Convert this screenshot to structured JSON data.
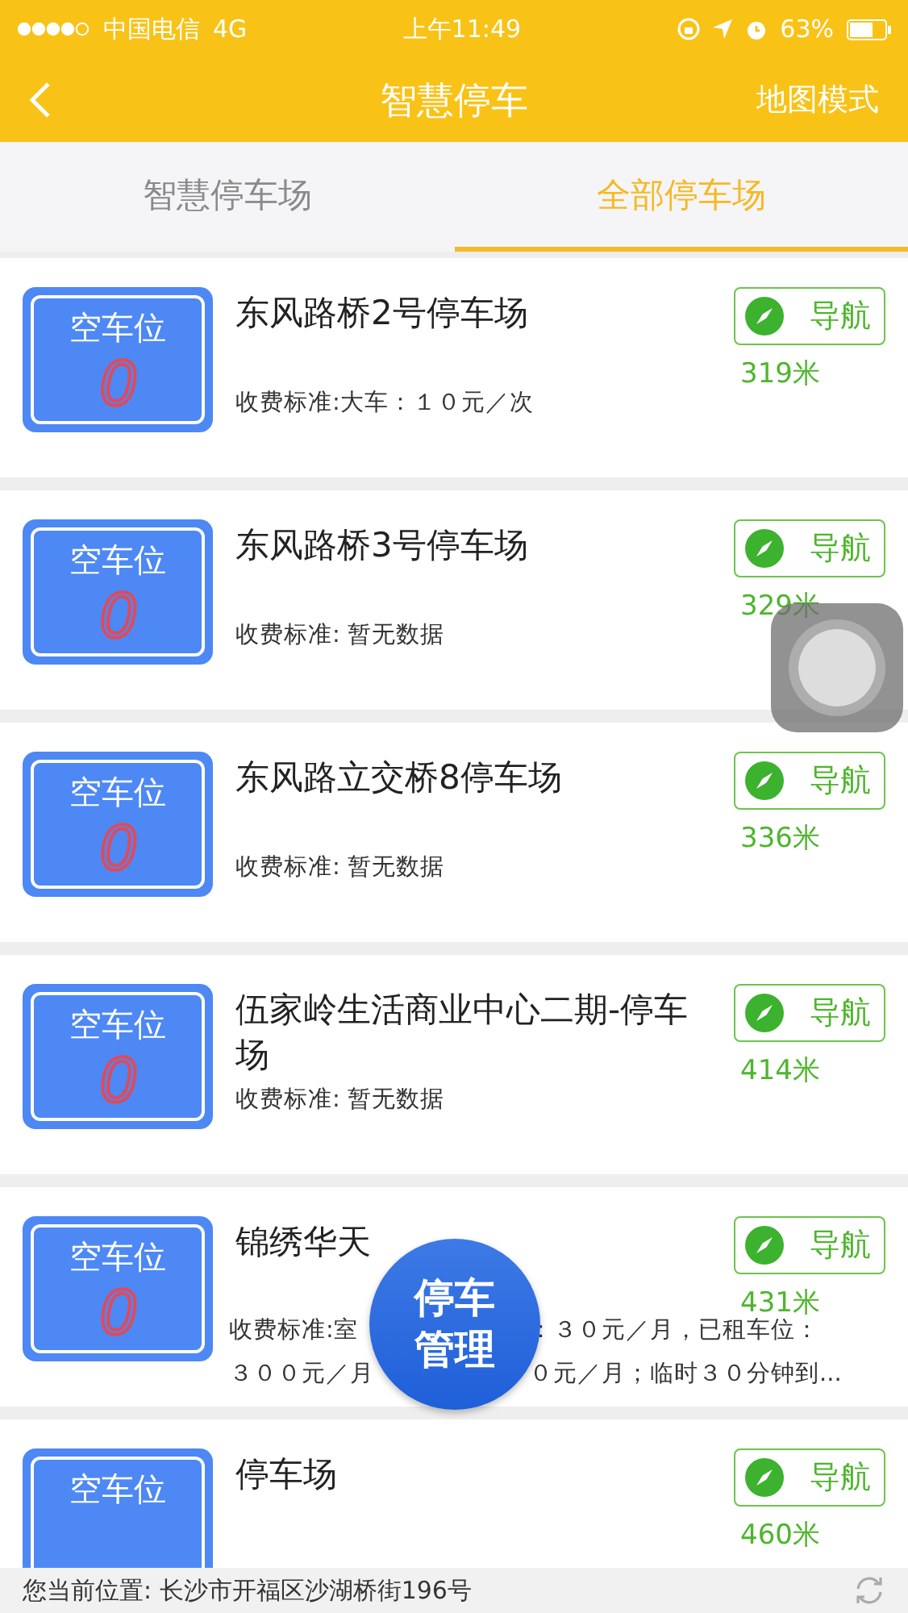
{
  "status_bar": {
    "carrier": "中国电信",
    "network": "4G",
    "time": "上午11:49",
    "battery": "63%"
  },
  "header": {
    "title": "智慧停车",
    "action": "地图模式"
  },
  "tabs": [
    {
      "label": "智慧停车场",
      "selected": false
    },
    {
      "label": "全部停车场",
      "selected": true
    }
  ],
  "lots": [
    {
      "slot_label": "空车位",
      "slot_count": "0",
      "name": "东风路桥2号停车场",
      "fee": "收费标准:大车：１０元／次",
      "nav": "导航",
      "distance": "319米"
    },
    {
      "slot_label": "空车位",
      "slot_count": "0",
      "name": "东风路桥3号停车场",
      "fee": "收费标准: 暂无数据",
      "nav": "导航",
      "distance": "329米"
    },
    {
      "slot_label": "空车位",
      "slot_count": "0",
      "name": "东风路立交桥8停车场",
      "fee": "收费标准: 暂无数据",
      "nav": "导航",
      "distance": "336米"
    },
    {
      "slot_label": "空车位",
      "slot_count": "0",
      "name": "伍家岭生活商业中心二期-停车场",
      "fee": "收费标准: 暂无数据",
      "nav": "导航",
      "distance": "414米"
    },
    {
      "slot_label": "空车位",
      "slot_count": "0",
      "name": "锦绣华天",
      "fee_segments": [
        "收费标准:室",
        "：３０元／月，已租车位：",
        "３００元／月",
        "０元／月；临时３０分钟到..."
      ],
      "nav": "导航",
      "distance": "431米"
    },
    {
      "slot_label": "空车位",
      "name": "停车场",
      "nav": "导航",
      "distance": "460米"
    }
  ],
  "floating_button": {
    "lines": [
      "停车",
      "管理"
    ]
  },
  "location_bar": {
    "text": "您当前位置: 长沙市开福区沙湖桥街196号"
  }
}
